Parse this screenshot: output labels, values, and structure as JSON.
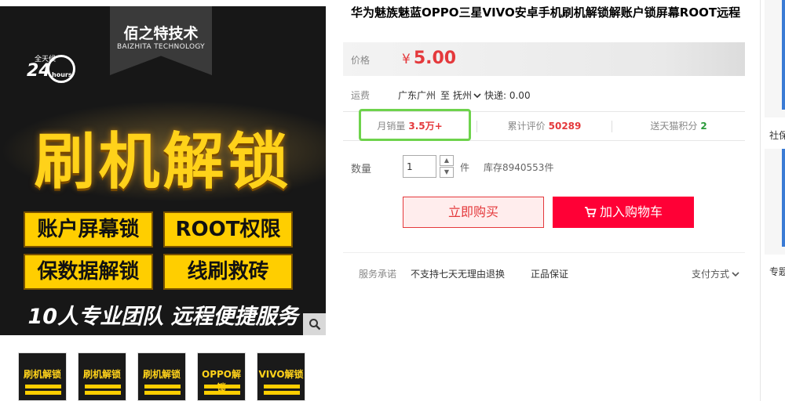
{
  "product": {
    "title": "华为魅族魅蓝OPPO三星VIVO安卓手机刷机解锁解账户锁屏幕ROOT远程",
    "image": {
      "brand": "佰之特技术",
      "brand_sub": "BAIZHITA TECHNOLOGY",
      "clock_label": "全天候",
      "clock_num": "24",
      "clock_unit": "hours",
      "headline": "刷机解锁",
      "tags": [
        "账户屏幕锁",
        "ROOT权限",
        "保数据解锁",
        "线刷救砖"
      ],
      "slogan": "10人专业团队 远程便捷服务"
    },
    "thumbnails": [
      "刷机解锁",
      "刷机解锁",
      "刷机解锁",
      "OPPO解锁",
      "VIVO解锁"
    ]
  },
  "price": {
    "label": "价格",
    "symbol": "¥",
    "value": "5.00"
  },
  "shipping": {
    "label": "运费",
    "from": "广东广州",
    "to_word": "至",
    "to": "抚州",
    "fee_text": "快递: 0.00"
  },
  "stats": {
    "monthly_sales_label": "月销量",
    "monthly_sales": "3.5万+",
    "reviews_label": "累计评价",
    "reviews": "50289",
    "points_label": "送天猫积分",
    "points": "2"
  },
  "quantity": {
    "label": "数量",
    "value": "1",
    "unit": "件",
    "stock": "库存8940553件"
  },
  "buttons": {
    "buy_now": "立即购买",
    "add_to_cart": "加入购物车"
  },
  "service": {
    "label": "服务承诺",
    "items": [
      "不支持七天无理由退换",
      "正品保证"
    ],
    "payment": "支付方式"
  },
  "sidebar_edge": {
    "item1": "社保",
    "item2": "专题"
  },
  "colors": {
    "price_red": "#e4393c",
    "cart_red": "#ff0036",
    "highlight_green": "#6ed34c"
  }
}
